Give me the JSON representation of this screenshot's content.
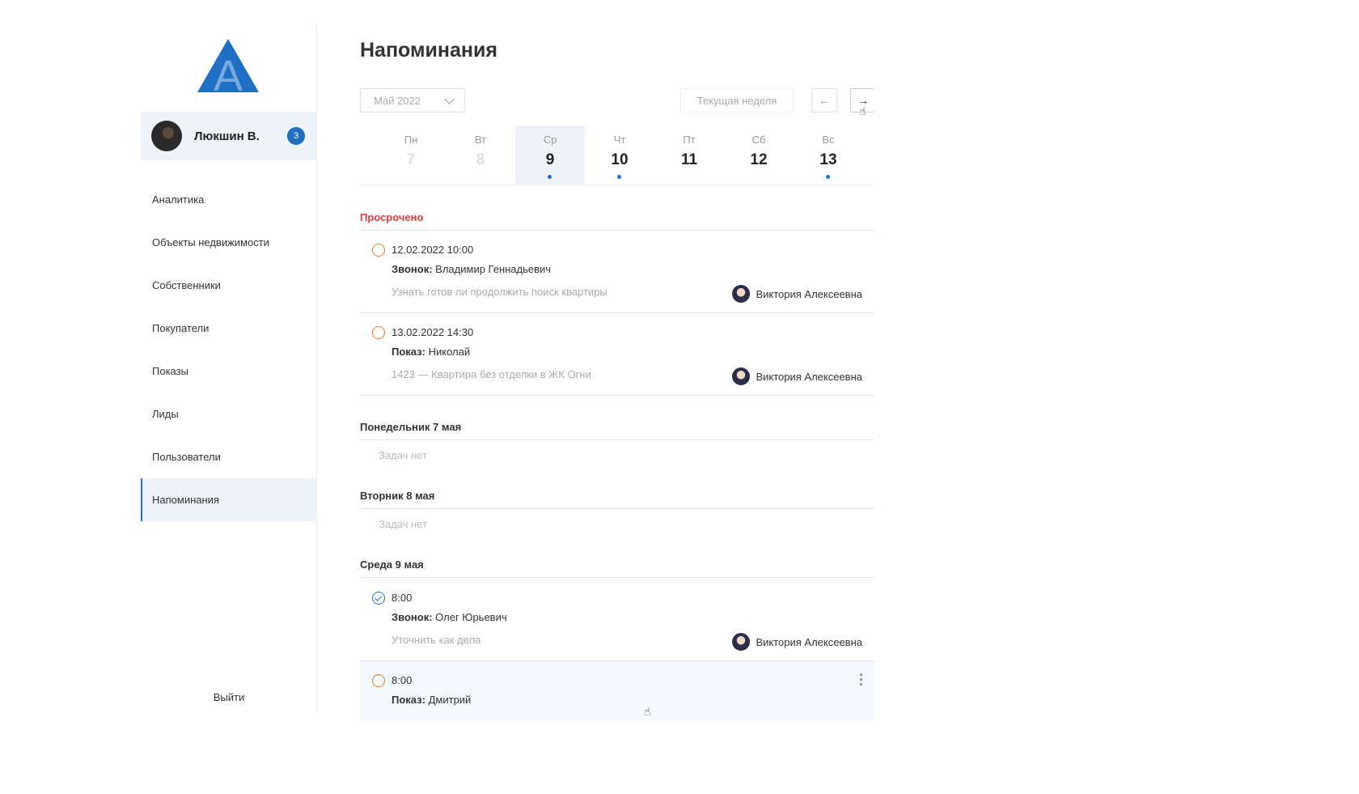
{
  "sidebar": {
    "logo_letter": "A",
    "user": {
      "name": "Люкшин В.",
      "badge": "3"
    },
    "items": [
      {
        "label": "Аналитика"
      },
      {
        "label": "Объекты недвижимости"
      },
      {
        "label": "Собственники"
      },
      {
        "label": "Покупатели"
      },
      {
        "label": "Показы"
      },
      {
        "label": "Лиды"
      },
      {
        "label": "Пользователи"
      },
      {
        "label": "Напоминания",
        "active": true
      }
    ],
    "logout_label": "Выйти"
  },
  "main": {
    "title": "Напоминания",
    "month_select": "Май 2022",
    "current_week_label": "Текущая неделя",
    "prev_arrow": "←",
    "next_arrow": "→",
    "days": [
      {
        "label": "Пн",
        "num": "7"
      },
      {
        "label": "Вт",
        "num": "8"
      },
      {
        "label": "Ср",
        "num": "9"
      },
      {
        "label": "Чт",
        "num": "10"
      },
      {
        "label": "Пт",
        "num": "11"
      },
      {
        "label": "Сб",
        "num": "12"
      },
      {
        "label": "Вс",
        "num": "13"
      }
    ],
    "overdue": {
      "title": "Просрочено",
      "tasks": [
        {
          "time": "12.02.2022 10:00",
          "type": "Звонок:",
          "person": "Владимир Геннадьевич",
          "note": "Узнать готов ли продолжить поиск квартиры",
          "assignee": "Виктория Алексеевна"
        },
        {
          "time": "13.02.2022 14:30",
          "type": "Показ:",
          "person": "Николай",
          "note": "1423 — Квартира без отделки в ЖК Огни",
          "assignee": "Виктория Алексеевна"
        }
      ]
    },
    "monday": {
      "title": "Понедельник 7 мая",
      "empty": "Задач нет"
    },
    "tuesday": {
      "title": "Вторник 8 мая",
      "empty": "Задач нет"
    },
    "wednesday": {
      "title": "Среда 9 мая",
      "tasks": [
        {
          "time": "8:00",
          "type": "Звонок:",
          "person": "Олег Юрьевич",
          "note": "Уточнить как дела",
          "assignee": "Виктория Алексеевна"
        },
        {
          "time": "8:00",
          "type": "Показ:",
          "person": "Дмитрий"
        }
      ]
    }
  },
  "colors": {
    "accent": "#1f6fc4",
    "overdue": "#e23b3b",
    "pending_status": "#f07a24",
    "selected_bg": "#eef3fa"
  }
}
